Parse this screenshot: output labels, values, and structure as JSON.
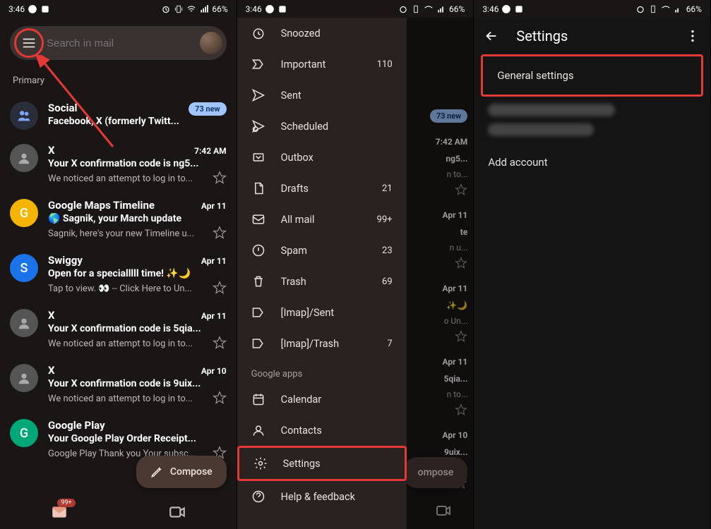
{
  "status": {
    "time": "3:46",
    "battery": "66%",
    "battery_icon": "66"
  },
  "screen1": {
    "search_placeholder": "Search in mail",
    "section": "Primary",
    "social": {
      "title": "Social",
      "preview": "Facebook, X (formerly Twitt...",
      "badge": "73 new"
    },
    "emails": [
      {
        "sender": "X",
        "time": "7:42 AM",
        "subject": "Your X confirmation code is ng5...",
        "preview": "We noticed an attempt to log in to...",
        "avatar_bg": "#555",
        "avatar_text": ""
      },
      {
        "sender": "Google Maps Timeline",
        "time": "Apr 11",
        "subject": "🌎 Sagnik, your March update",
        "preview": "Sagnik, here's your new Timeline u...",
        "avatar_bg": "#f5b400",
        "avatar_text": "G"
      },
      {
        "sender": "Swiggy",
        "time": "Apr 11",
        "subject": "Open for a specialllll time! ✨🌙",
        "preview": "Tap to view. 👀 -- Click Here to Un...",
        "avatar_bg": "#1a73e8",
        "avatar_text": "S"
      },
      {
        "sender": "X",
        "time": "Apr 11",
        "subject": "Your X confirmation code is 5qia...",
        "preview": "We noticed an attempt to log in to...",
        "avatar_bg": "#555",
        "avatar_text": ""
      },
      {
        "sender": "X",
        "time": "Apr 10",
        "subject": "Your X confirmation code is 9uix...",
        "preview": "We noticed an attempt to log in to...",
        "avatar_bg": "#555",
        "avatar_text": ""
      },
      {
        "sender": "Google Play",
        "time": "",
        "subject": "Your Google Play Order Receipt...",
        "preview": "Google Play Thank you Your subsc...",
        "avatar_bg": "#00a877",
        "avatar_text": "G"
      }
    ],
    "compose": "Compose",
    "nav_badge": "99+"
  },
  "screen2": {
    "drawer_items": [
      {
        "icon": "snooze",
        "label": "Snoozed",
        "count": ""
      },
      {
        "icon": "important",
        "label": "Important",
        "count": "110"
      },
      {
        "icon": "sent",
        "label": "Sent",
        "count": ""
      },
      {
        "icon": "scheduled",
        "label": "Scheduled",
        "count": ""
      },
      {
        "icon": "outbox",
        "label": "Outbox",
        "count": ""
      },
      {
        "icon": "drafts",
        "label": "Drafts",
        "count": "21"
      },
      {
        "icon": "allmail",
        "label": "All mail",
        "count": "99+"
      },
      {
        "icon": "spam",
        "label": "Spam",
        "count": "23"
      },
      {
        "icon": "trash",
        "label": "Trash",
        "count": "69"
      },
      {
        "icon": "label",
        "label": "[Imap]/Sent",
        "count": ""
      },
      {
        "icon": "label",
        "label": "[Imap]/Trash",
        "count": "7"
      }
    ],
    "section_label": "Google apps",
    "apps": [
      {
        "icon": "calendar",
        "label": "Calendar"
      },
      {
        "icon": "contacts",
        "label": "Contacts"
      }
    ],
    "settings": "Settings",
    "help": "Help & feedback",
    "bg_badge": "73 new",
    "bg_compose": "ompose",
    "bg_times": [
      "7:42 AM",
      "ng5...",
      "n to...",
      "Apr 11",
      "te",
      "n u...",
      "Apr 11",
      "✨🌙",
      "o Un...",
      "Apr 11",
      "5qia...",
      "n to...",
      "Apr 10",
      "9uix...",
      "n to..."
    ]
  },
  "screen3": {
    "title": "Settings",
    "general": "General settings",
    "add_account": "Add account"
  }
}
